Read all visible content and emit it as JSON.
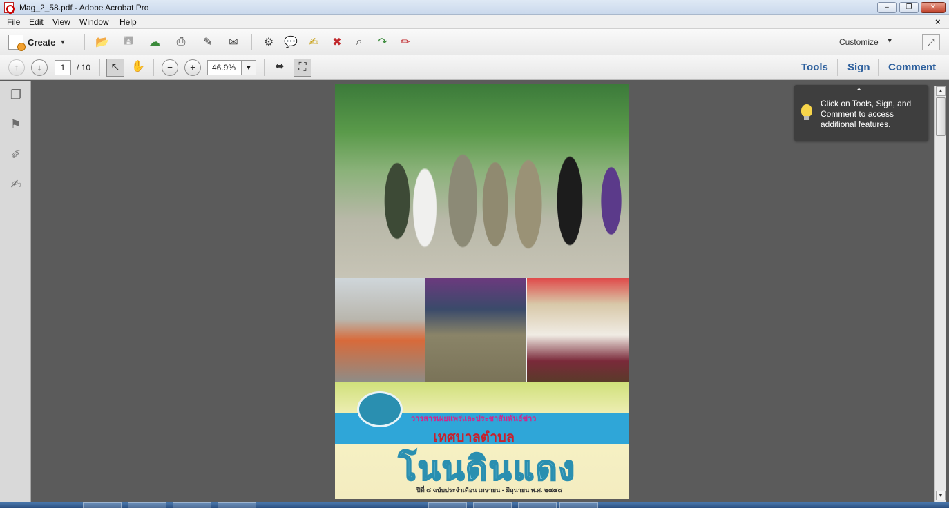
{
  "window": {
    "title": "Mag_2_58.pdf - Adobe Acrobat Pro",
    "minimize_icon": "minimize-icon",
    "maximize_icon": "maximize-icon",
    "close_icon": "close-icon"
  },
  "menu": {
    "items": [
      "File",
      "Edit",
      "View",
      "Window",
      "Help"
    ],
    "close_document_glyph": "×"
  },
  "toolbar": {
    "create_label": "Create",
    "customize_label": "Customize",
    "icons": [
      "open-icon",
      "save-icon",
      "cloud-upload-icon",
      "print-icon",
      "edit-pdf-icon",
      "email-icon",
      "settings-icon",
      "comment-icon",
      "highlight-icon",
      "delete-pages-icon",
      "search-document-icon",
      "export-icon",
      "sign-document-icon"
    ]
  },
  "navigation": {
    "current_page": "1",
    "total_pages": "/ 10",
    "zoom_value": "46.9%"
  },
  "panels": {
    "tools": "Tools",
    "sign": "Sign",
    "comment": "Comment"
  },
  "tooltip": {
    "text": "Click on Tools, Sign, and Comment to access additional features."
  },
  "cover": {
    "subtitle": "วารสารเผยแพร่และประชาสัมพันธ์ข่าว",
    "municipality": "เทศบาลตำบล",
    "title": "โนนดินแดง",
    "issue_line": "ปีที่ ๘ ฉบับประจำเดือน เมษายน - มิถุนายน พ.ศ. ๒๕๕๘"
  },
  "colors": {
    "panel_link": "#2b5e9c",
    "tooltip_bg": "#3e3e3e",
    "doc_background": "#5b5b5b"
  }
}
